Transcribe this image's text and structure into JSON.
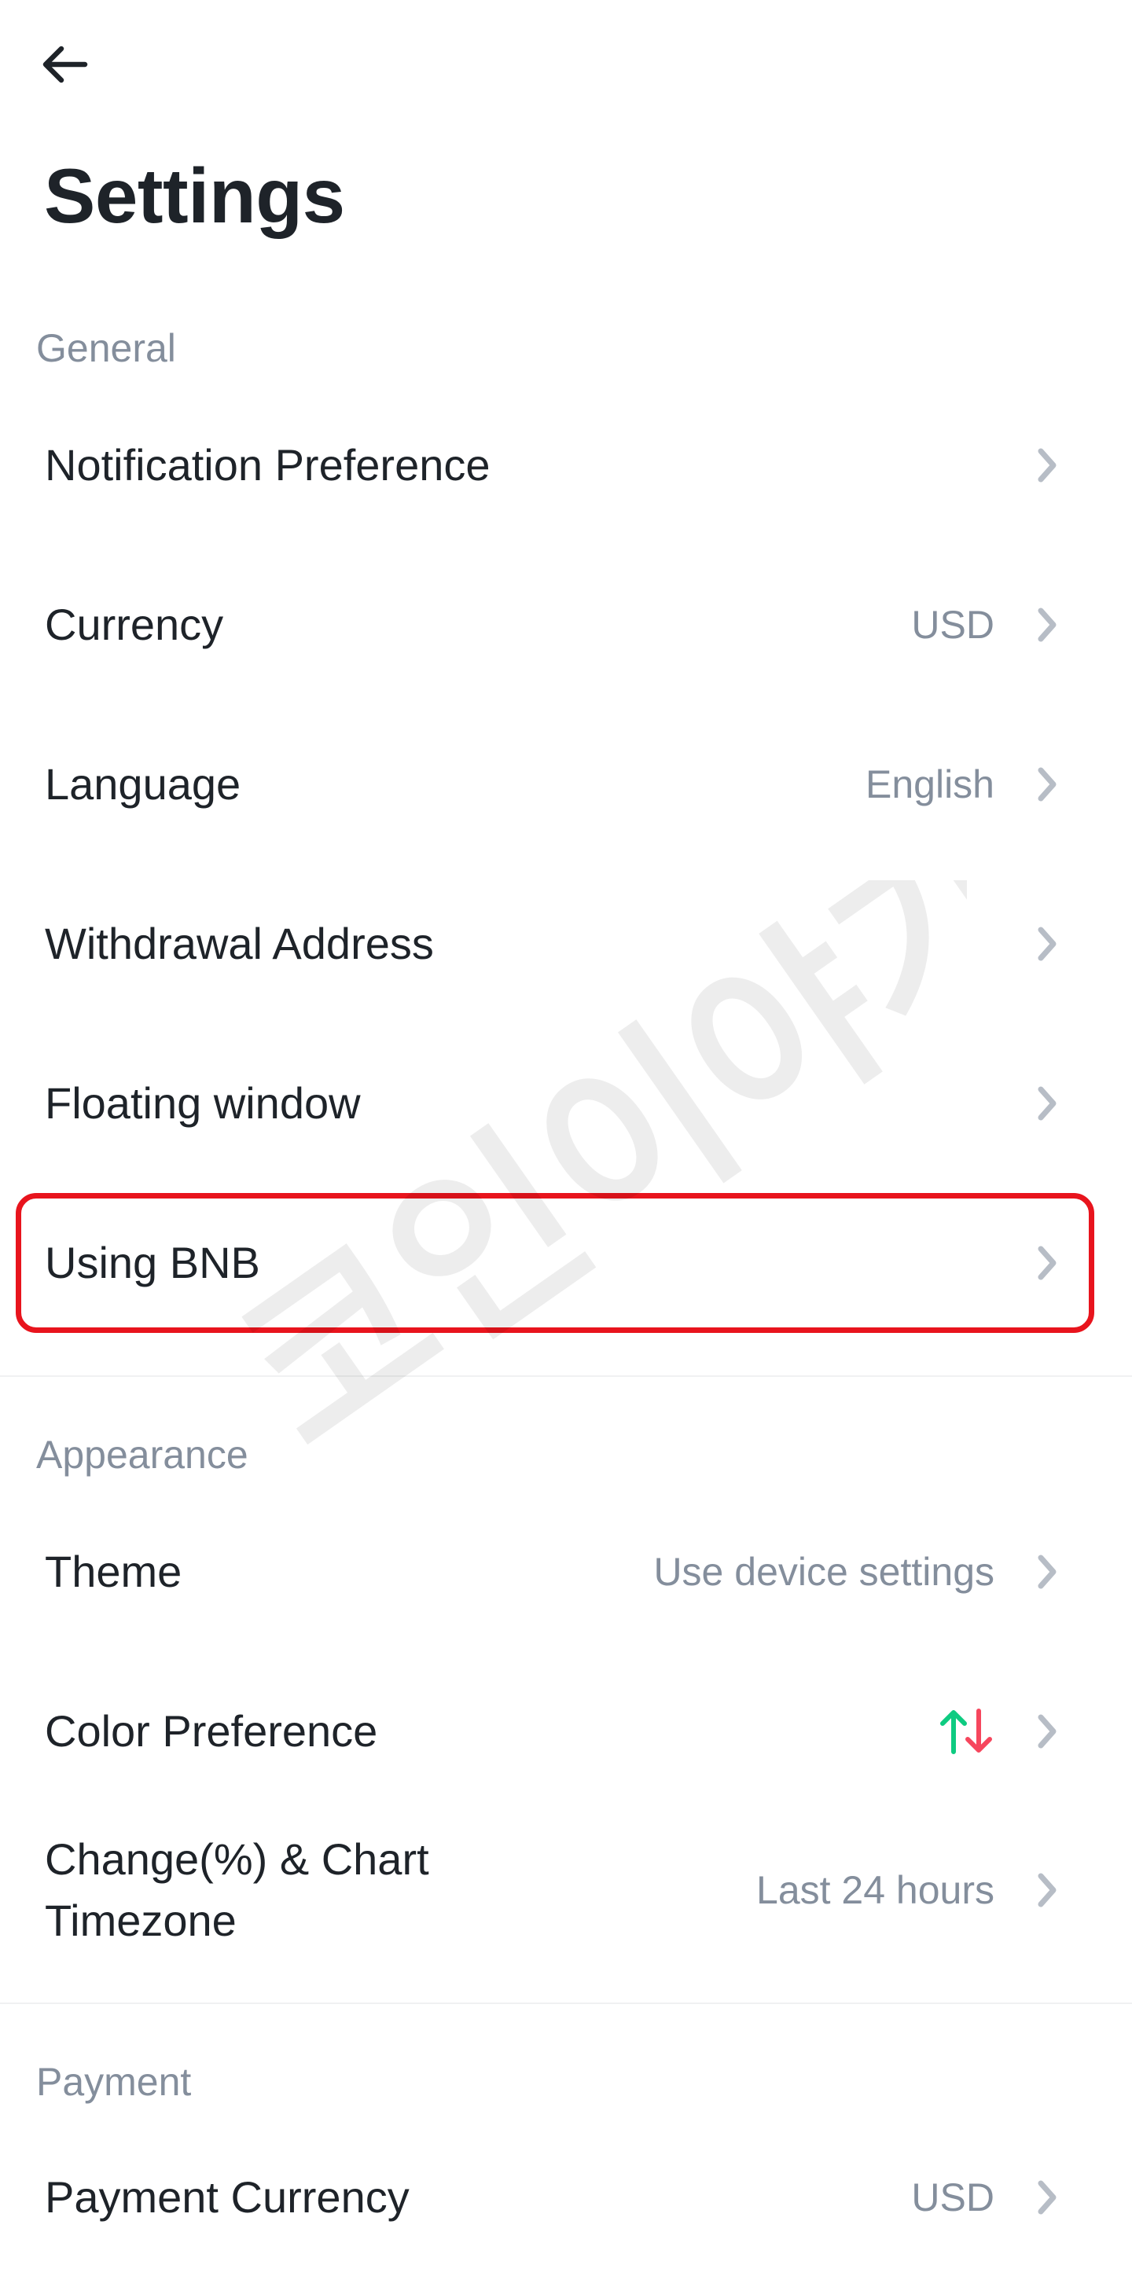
{
  "header": {
    "back_icon": "arrow-left-icon",
    "title": "Settings"
  },
  "sections": {
    "general": {
      "label": "General",
      "items": [
        {
          "label": "Notification Preference",
          "value": ""
        },
        {
          "label": "Currency",
          "value": "USD"
        },
        {
          "label": "Language",
          "value": "English"
        },
        {
          "label": "Withdrawal Address",
          "value": ""
        },
        {
          "label": "Floating window",
          "value": ""
        },
        {
          "label": "Using BNB",
          "value": ""
        }
      ]
    },
    "appearance": {
      "label": "Appearance",
      "items": [
        {
          "label": "Theme",
          "value": "Use device settings"
        },
        {
          "label": "Color Preference",
          "value": "",
          "icon": "up-down-arrows-icon"
        },
        {
          "label": "Change(%) & Chart Timezone",
          "value": "Last 24 hours"
        }
      ]
    },
    "payment": {
      "label": "Payment",
      "items": [
        {
          "label": "Payment Currency",
          "value": "USD"
        }
      ]
    }
  },
  "watermark": "코인이야기",
  "colors": {
    "text_primary": "#1e2329",
    "text_secondary": "#848e9c",
    "chevron": "#b7bdc6",
    "highlight": "#e8141d",
    "up": "#0ecb81",
    "down": "#f6465d"
  }
}
